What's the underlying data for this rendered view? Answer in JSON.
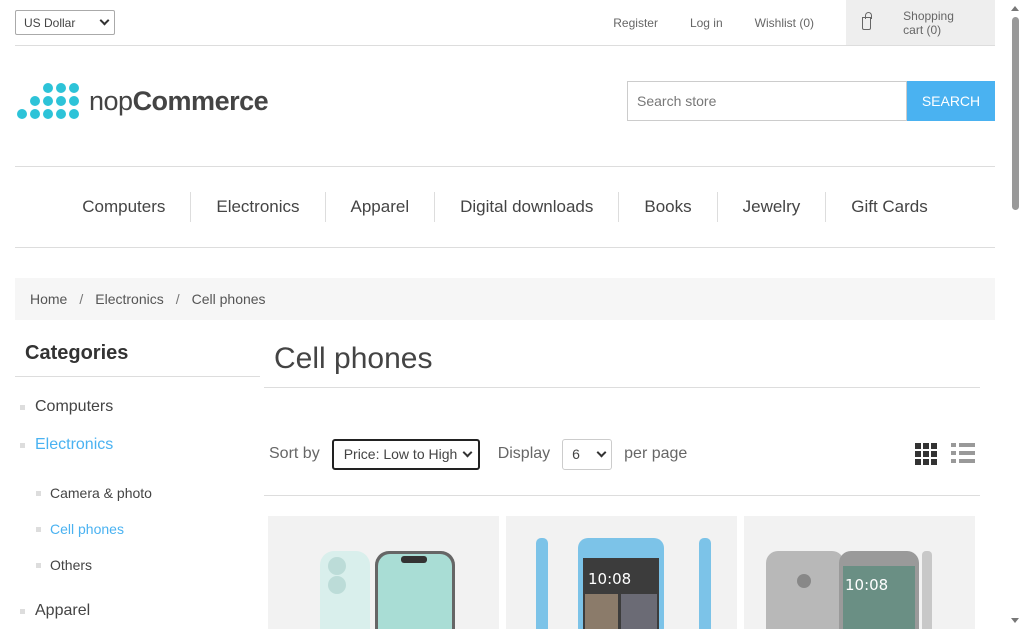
{
  "header": {
    "currency": "US Dollar",
    "links": [
      "Register",
      "Log in",
      "Wishlist (0)"
    ],
    "cart_label": "Shopping cart (0)"
  },
  "logo": {
    "light": "nop",
    "bold": "Commerce"
  },
  "search": {
    "placeholder": "Search store",
    "button": "SEARCH"
  },
  "menu": [
    "Computers",
    "Electronics",
    "Apparel",
    "Digital downloads",
    "Books",
    "Jewelry",
    "Gift Cards"
  ],
  "breadcrumb": {
    "home": "Home",
    "separator": "/",
    "parent": "Electronics",
    "current": "Cell phones"
  },
  "sidebar": {
    "title": "Categories",
    "categories": [
      {
        "label": "Computers"
      },
      {
        "label": "Electronics",
        "active": true
      },
      {
        "label": "Apparel"
      }
    ],
    "subcategories": [
      {
        "label": "Camera & photo"
      },
      {
        "label": "Cell phones",
        "active": true
      },
      {
        "label": "Others"
      }
    ]
  },
  "main": {
    "title": "Cell phones",
    "sort_label": "Sort by",
    "sort_value": "Price: Low to High",
    "display_label": "Display",
    "display_value": "6",
    "per_page_label": "per page"
  },
  "colors": {
    "accent": "#4ab2f1",
    "logo_dots": "#2dc3d8"
  },
  "icons": [
    "cart-icon",
    "chevron-down-icon",
    "grid-view-icon",
    "list-view-icon"
  ]
}
